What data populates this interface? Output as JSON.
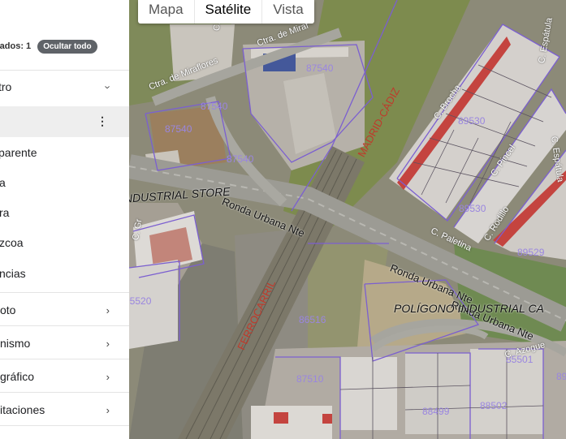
{
  "sidebar": {
    "selected_label": "tados: 1",
    "hide_all_label": "Ocultar todo",
    "sections": [
      {
        "label": "tro"
      },
      {
        "label": "oto"
      },
      {
        "label": "nismo"
      },
      {
        "label": "gráfico"
      },
      {
        "label": "itaciones"
      }
    ],
    "sublayers": [
      {
        "label": "parente"
      },
      {
        "label": "a"
      },
      {
        "label": "ra"
      },
      {
        "label": "zcoa"
      },
      {
        "label": "ncias"
      }
    ]
  },
  "map_type": {
    "options": [
      "Mapa",
      "Satélite",
      "Vista"
    ],
    "active": "Satélite"
  },
  "map": {
    "streets": [
      "Ctra. de Miraflores",
      "Ctra. de Miraf",
      "C. Alp",
      "Ronda Urbana Nte",
      "Ronda Urbana Nte",
      "Ronda Urbana Nte",
      "C. Brocha",
      "C. Pincel",
      "C. Rodillo",
      "C. Paletina",
      "C. Espátula",
      "C. Espátula",
      "C. Azogue",
      "C. Gr",
      "INDUSTRIAL STORE",
      "POLÍGONO INDUSTRIAL CA",
      "MADRID-CÁDIZ",
      "FERROCARRIL"
    ],
    "parcels": [
      "87540",
      "87540",
      "87540",
      "87540",
      "87540",
      "89530",
      "89530",
      "89529",
      "95520",
      "86516",
      "87510",
      "88499",
      "88502",
      "85501",
      "89"
    ],
    "colors": {
      "parcel_line": "#7b5fd0",
      "parcel_text": "#9a86e0",
      "railway_text": "#c0392b"
    }
  }
}
